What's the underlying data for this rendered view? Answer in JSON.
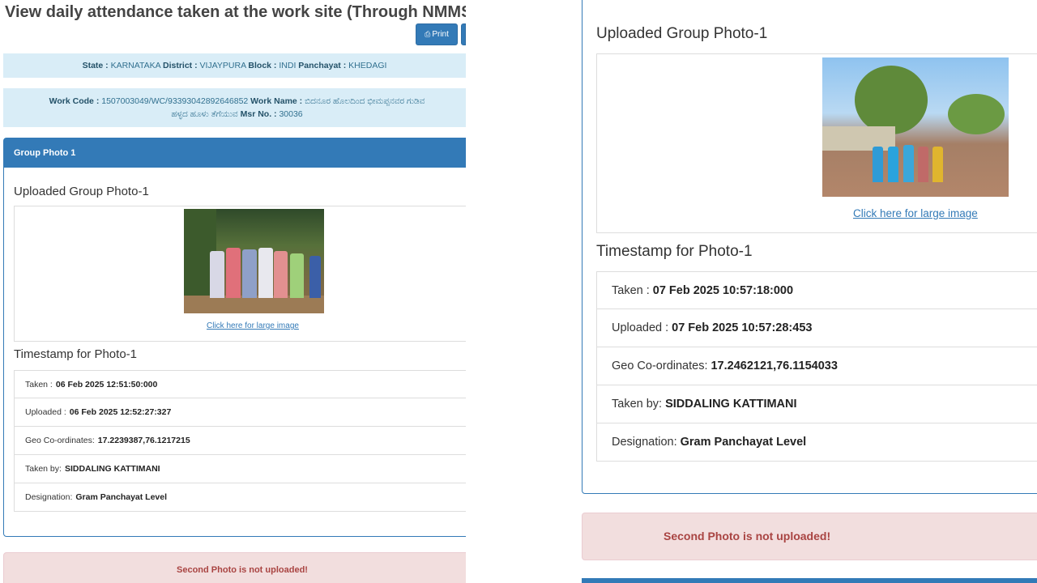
{
  "left": {
    "page_title": "View daily attendance taken at the work site (Through NMMS",
    "print_label": "Print",
    "location": {
      "state_label": "State :",
      "state": "KARNATAKA",
      "district_label": "District :",
      "district": "VIJAYPURA",
      "block_label": "Block :",
      "block": "INDI",
      "panchayat_label": "Panchayat :",
      "panchayat": "KHEDAGI"
    },
    "work": {
      "code_label": "Work Code :",
      "code": "1507003049/WC/93393042892646852",
      "name_label": "Work Name :",
      "name_line1": "ಬಿದನೂರ ಹೊಲದಿಂದ ಭೀಮಪ್ಪನವರ ಗುಡಿವ",
      "name_line2": "ಹಳ್ಳದ ಹೂಳು ತೆಗೆಯುವ",
      "msr_label": "Msr No. :",
      "msr": "30036"
    },
    "panel_heading": "Group Photo 1",
    "uploaded_heading": "Uploaded Group Photo-1",
    "large_image_link": "Click here for large image",
    "timestamp_heading": "Timestamp for Photo-1",
    "rows": [
      {
        "label": "Taken :",
        "value": "06 Feb 2025 12:51:50:000"
      },
      {
        "label": "Uploaded :",
        "value": "06 Feb 2025 12:52:27:327"
      },
      {
        "label": "Geo Co-ordinates:",
        "value": "17.2239387,76.1217215"
      },
      {
        "label": "Taken by:",
        "value": "SIDDALING KATTIMANI"
      },
      {
        "label": "Designation:",
        "value": "Gram Panchayat Level"
      }
    ],
    "alert": "Second Photo is not uploaded!"
  },
  "right": {
    "uploaded_heading": "Uploaded Group Photo-1",
    "large_image_link": "Click here for large image",
    "timestamp_heading": "Timestamp for Photo-1",
    "rows": [
      {
        "label": "Taken :",
        "value": "07 Feb 2025 10:57:18:000"
      },
      {
        "label": "Uploaded :",
        "value": "07 Feb 2025 10:57:28:453"
      },
      {
        "label": "Geo Co-ordinates:",
        "value": "17.2462121,76.1154033"
      },
      {
        "label": "Taken by:",
        "value": "SIDDALING KATTIMANI"
      },
      {
        "label": "Designation:",
        "value": "Gram Panchayat Level"
      }
    ],
    "alert": "Second Photo is not uploaded!"
  },
  "icons": {
    "print": "printer-icon"
  },
  "colors": {
    "primary": "#337ab7",
    "info_bg": "#d9edf7",
    "alert_bg": "#f2dede",
    "alert_text": "#a94442"
  }
}
